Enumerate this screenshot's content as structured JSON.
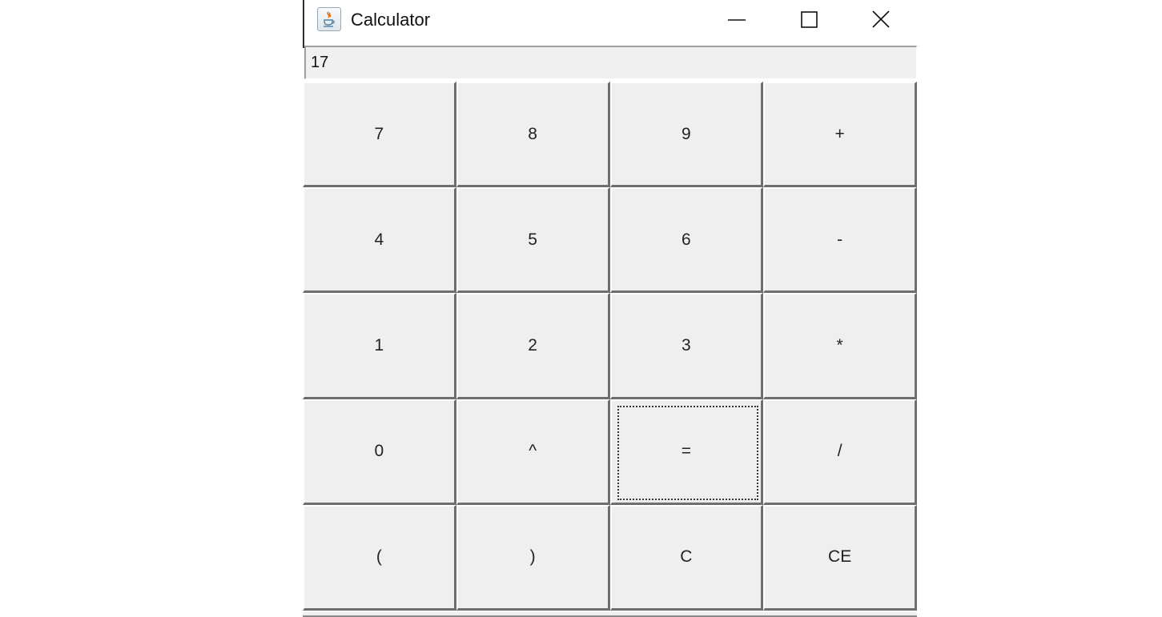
{
  "window": {
    "title": "Calculator",
    "icon": "java-cup-icon",
    "controls": {
      "minimize": "minimize-icon",
      "maximize": "maximize-icon",
      "close": "close-icon"
    }
  },
  "display": {
    "value": "17"
  },
  "keypad": {
    "keys": [
      {
        "label": "7",
        "name": "key-7"
      },
      {
        "label": "8",
        "name": "key-8"
      },
      {
        "label": "9",
        "name": "key-9"
      },
      {
        "label": "+",
        "name": "key-plus"
      },
      {
        "label": "4",
        "name": "key-4"
      },
      {
        "label": "5",
        "name": "key-5"
      },
      {
        "label": "6",
        "name": "key-6"
      },
      {
        "label": "-",
        "name": "key-minus"
      },
      {
        "label": "1",
        "name": "key-1"
      },
      {
        "label": "2",
        "name": "key-2"
      },
      {
        "label": "3",
        "name": "key-3"
      },
      {
        "label": "*",
        "name": "key-multiply"
      },
      {
        "label": "0",
        "name": "key-0"
      },
      {
        "label": "^",
        "name": "key-power"
      },
      {
        "label": "=",
        "name": "key-equals",
        "focused": true
      },
      {
        "label": "/",
        "name": "key-divide"
      },
      {
        "label": "(",
        "name": "key-open-paren"
      },
      {
        "label": ")",
        "name": "key-close-paren"
      },
      {
        "label": "C",
        "name": "key-clear"
      },
      {
        "label": "CE",
        "name": "key-clear-entry"
      }
    ]
  }
}
